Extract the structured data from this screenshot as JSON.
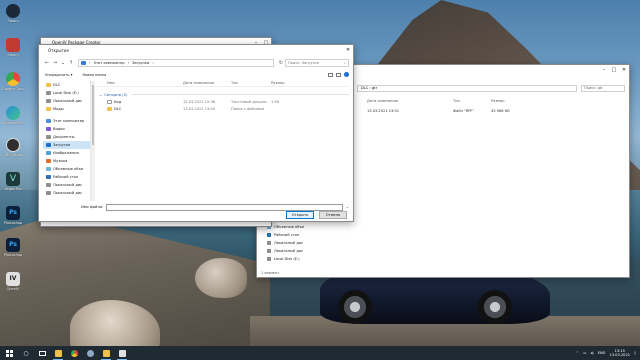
{
  "desktop": {
    "icons": [
      {
        "label": "Steam",
        "color": "#1b2838"
      },
      {
        "label": "Steam",
        "color": "#2a475e"
      },
      {
        "label": "Google Chrome",
        "color": "#e8453c"
      },
      {
        "label": "Microsoft Edge",
        "color": "#2a8fd8"
      },
      {
        "label": "OBS Studio",
        "color": "#302e31"
      },
      {
        "label": "Vegas Pro",
        "color": "#1c6e6a"
      },
      {
        "label": "Photoshop",
        "color": "#1b3a6b"
      },
      {
        "label": "Photoshop",
        "color": "#1b3a6b"
      },
      {
        "label": "OpenIV",
        "color": "#d4d4d4"
      }
    ]
  },
  "explorer": {
    "title": "",
    "breadcrumb": "DLC  ›  gtr",
    "search_placeholder": "Поиск: gtr",
    "columns": {
      "date": "Дата изменения",
      "type": "Тип",
      "size": "Размер"
    },
    "row": {
      "date": "13.03.2021 13:01",
      "type": "Файл \"RPF\"",
      "size": "43 966 КБ"
    },
    "nav_items": [
      "Объемные объе",
      "Рабочий стол",
      "Локальный дис",
      "Локальный дис",
      "Local Disk (E:)"
    ],
    "status": "1 элемент"
  },
  "package_window": {
    "title": "OpenIV Package Creator"
  },
  "dialog": {
    "title": "Открытие",
    "breadcrumb": [
      "Этот компьютер",
      "Загрузки"
    ],
    "search_placeholder": "Поиск: Загрузки",
    "cmd_organize": "Упорядочить ▾",
    "cmd_new_folder": "Новая папка",
    "nav_items": [
      {
        "label": "DLC",
        "icon": "#f0c24a",
        "selected": false
      },
      {
        "label": "Local Disk (E:)",
        "icon": "#8e8e8e",
        "selected": false
      },
      {
        "label": "Локальный дис",
        "icon": "#8e8e8e",
        "selected": false
      },
      {
        "label": "Моды",
        "icon": "#f0c24a",
        "selected": false
      },
      {
        "label": "Этот компьютер",
        "icon": "#4b8fd6",
        "selected": false
      },
      {
        "label": "Видео",
        "icon": "#7b5bd6",
        "selected": false
      },
      {
        "label": "Документы",
        "icon": "#8e8e8e",
        "selected": false
      },
      {
        "label": "Загрузки",
        "icon": "#1a6fd1",
        "selected": true
      },
      {
        "label": "Изображения",
        "icon": "#4ba3d6",
        "selected": false
      },
      {
        "label": "Музыка",
        "icon": "#e06c2a",
        "selected": false
      },
      {
        "label": "Объемные объе",
        "icon": "#6fb6e0",
        "selected": false
      },
      {
        "label": "Рабочий стол",
        "icon": "#2f6fb3",
        "selected": false
      },
      {
        "label": "Локальный дис",
        "icon": "#8e8e8e",
        "selected": false
      },
      {
        "label": "Локальный дис",
        "icon": "#8e8e8e",
        "selected": false
      },
      {
        "label": "Local Disk (E:)",
        "icon": "#8e8e8e",
        "selected": false
      }
    ],
    "columns": {
      "name": "Имя",
      "date": "Дата изменения",
      "type": "Тип",
      "size": "Размер"
    },
    "group_label": "Сегодня (2)",
    "files": [
      {
        "name": "Код",
        "date": "13.03.2021 12:38",
        "type": "Текстовый докуме...",
        "size": "1 КБ"
      },
      {
        "name": "DLC",
        "date": "13.03.2021 13:00",
        "type": "Папка с файлами",
        "size": ""
      }
    ],
    "filename_label": "Имя файла:",
    "filename_value": "",
    "open_label": "Открыть",
    "cancel_label": "Отмена"
  },
  "taskbar": {
    "apps": [
      {
        "name": "explorer",
        "color": "#f0c24a",
        "active": true
      },
      {
        "name": "chrome",
        "color": "#e8453c",
        "active": false
      },
      {
        "name": "steam",
        "color": "#8fa8c4",
        "active": false
      },
      {
        "name": "folder",
        "color": "#f0c24a",
        "active": true
      },
      {
        "name": "openiv",
        "color": "#e0e0e0",
        "active": true
      }
    ],
    "lang": "ENG",
    "time": "13:15",
    "date": "13.03.2021"
  }
}
